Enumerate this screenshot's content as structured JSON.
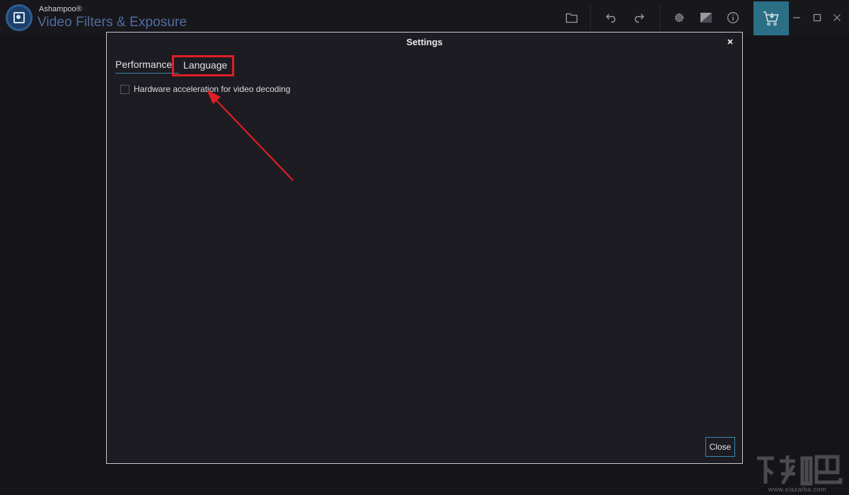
{
  "app": {
    "brand_small": "Ashampoo®",
    "brand_name": "Video Filters & Exposure",
    "accent_color": "#2b6f86",
    "toolbar_icons": [
      "folder-icon",
      "undo-icon",
      "redo-icon",
      "gear-icon",
      "compare-icon",
      "info-icon",
      "cart-icon"
    ],
    "window_controls": [
      "minimize-icon",
      "maximize-icon",
      "close-icon"
    ]
  },
  "dialog": {
    "title": "Settings",
    "tabs": [
      {
        "label": "Performance"
      },
      {
        "label": "Language"
      }
    ],
    "options": [
      {
        "label": "Hardware acceleration for video decoding",
        "checked": false
      }
    ],
    "close_label": "Close"
  },
  "annotation": {
    "highlight_color": "#e01e26"
  },
  "watermark": {
    "text": "www.xiazaiba.com"
  }
}
